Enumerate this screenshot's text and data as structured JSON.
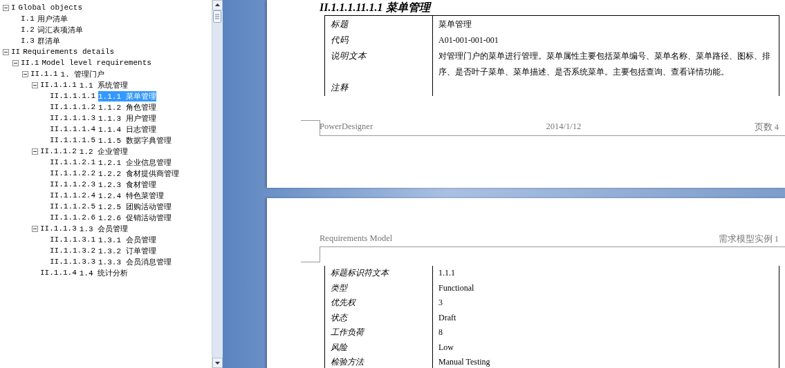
{
  "outline": {
    "items": [
      {
        "code": "I",
        "title": "Global objects",
        "expanded": true,
        "children": [
          {
            "code": "I.1",
            "title": "用户清单",
            "selected": false
          },
          {
            "code": "I.2",
            "title": "词汇表项清单",
            "selected": false
          },
          {
            "code": "I.3",
            "title": "群清单",
            "selected": false
          }
        ],
        "selected": false
      },
      {
        "code": "II",
        "title": "Requirements details",
        "expanded": true,
        "selected": false,
        "children": [
          {
            "code": "II.1",
            "title": "Model level requirements",
            "expanded": true,
            "selected": false,
            "children": [
              {
                "code": "II.1.1",
                "title": "1.  管理门户",
                "expanded": true,
                "selected": false,
                "children": [
                  {
                    "code": "II.1.1.1",
                    "title": "1.1 系统管理",
                    "expanded": true,
                    "selected": false,
                    "children": [
                      {
                        "code": "II.1.1.1.1",
                        "title": "1.1.1 菜单管理",
                        "selected": true
                      },
                      {
                        "code": "II.1.1.1.2",
                        "title": "1.1.2 角色管理",
                        "selected": false
                      },
                      {
                        "code": "II.1.1.1.3",
                        "title": "1.1.3 用户管理",
                        "selected": false
                      },
                      {
                        "code": "II.1.1.1.4",
                        "title": "1.1.4 日志管理",
                        "selected": false
                      },
                      {
                        "code": "II.1.1.1.5",
                        "title": "1.1.5 数据字典管理",
                        "selected": false
                      }
                    ]
                  },
                  {
                    "code": "II.1.1.2",
                    "title": "1.2 企业管理",
                    "expanded": true,
                    "selected": false,
                    "children": [
                      {
                        "code": "II.1.1.2.1",
                        "title": "1.2.1 企业信息管理",
                        "selected": false
                      },
                      {
                        "code": "II.1.1.2.2",
                        "title": "1.2.2 食材提供商管理",
                        "selected": false
                      },
                      {
                        "code": "II.1.1.2.3",
                        "title": "1.2.3 食材管理",
                        "selected": false
                      },
                      {
                        "code": "II.1.1.2.4",
                        "title": "1.2.4 特色菜管理",
                        "selected": false
                      },
                      {
                        "code": "II.1.1.2.5",
                        "title": "1.2.5 团购活动管理",
                        "selected": false
                      },
                      {
                        "code": "II.1.1.2.6",
                        "title": "1.2.6 促销活动管理",
                        "selected": false
                      }
                    ]
                  },
                  {
                    "code": "II.1.1.3",
                    "title": "1.3 会员管理",
                    "expanded": true,
                    "selected": false,
                    "children": [
                      {
                        "code": "II.1.1.3.1",
                        "title": "1.3.1 会员管理",
                        "selected": false
                      },
                      {
                        "code": "II.1.1.3.2",
                        "title": "1.3.2 订单管理",
                        "selected": false
                      },
                      {
                        "code": "II.1.1.3.3",
                        "title": "1.3.3 会员消息管理",
                        "selected": false
                      }
                    ]
                  },
                  {
                    "code": "II.1.1.4",
                    "title": "1.4 统计分析",
                    "selected": false
                  }
                ]
              }
            ]
          }
        ]
      }
    ]
  },
  "document": {
    "pages": [
      {
        "heading": "II.1.1.1.11.1.1 菜单管理",
        "properties": [
          {
            "name": "标题",
            "value": "菜单管理"
          },
          {
            "name": "代码",
            "value": "A01-001-001-001"
          },
          {
            "name": "说明文本",
            "value": "对管理门户的菜单进行管理。菜单属性主要包括菜单编号、菜单名称、菜单路径、图标、排序、是否叶子菜单、菜单描述、是否系统菜单。主要包括查询、查看详情功能。"
          },
          {
            "name": "注释"
          }
        ],
        "footer": {
          "left": "PowerDesigner",
          "center": "2014/1/12",
          "right": "页数 4"
        }
      },
      {
        "header": {
          "left": "Requirements Model",
          "right": "需求模型实例 1"
        },
        "properties": [
          {
            "name": "标题标识符文本",
            "value": "1.1.1"
          },
          {
            "name": "类型",
            "value": "Functional"
          },
          {
            "name": "优先权",
            "value": "3"
          },
          {
            "name": "状态",
            "value": "Draft"
          },
          {
            "name": "工作负荷",
            "value": "8"
          },
          {
            "name": "风险",
            "value": "Low"
          },
          {
            "name": "检验方法",
            "value": "Manual Testing"
          }
        ]
      }
    ]
  }
}
